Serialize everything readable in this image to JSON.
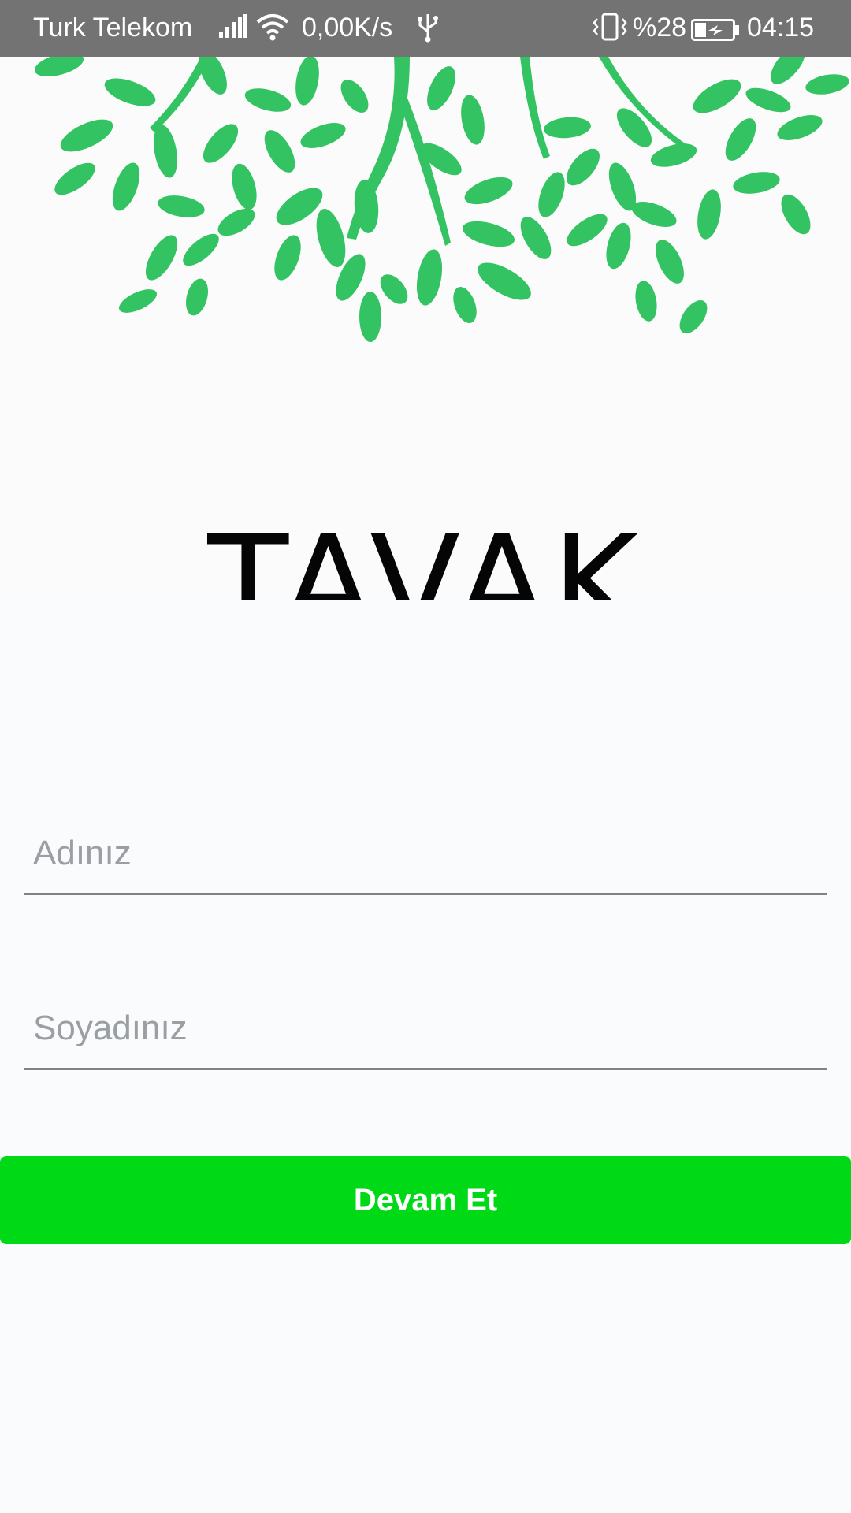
{
  "status_bar": {
    "carrier": "Turk Telekom",
    "network_speed": "0,00K/s",
    "battery_percent": "%28",
    "time": "04:15",
    "icons": [
      "signal-icon",
      "wifi-icon",
      "usb-icon",
      "vibrate-icon",
      "battery-charging-icon"
    ]
  },
  "brand": {
    "name": "TAVAK",
    "leaf_color": "#33c363"
  },
  "form": {
    "first_name_placeholder": "Adınız",
    "last_name_placeholder": "Soyadınız",
    "continue_label": "Devam Et",
    "button_color": "#00d915"
  }
}
